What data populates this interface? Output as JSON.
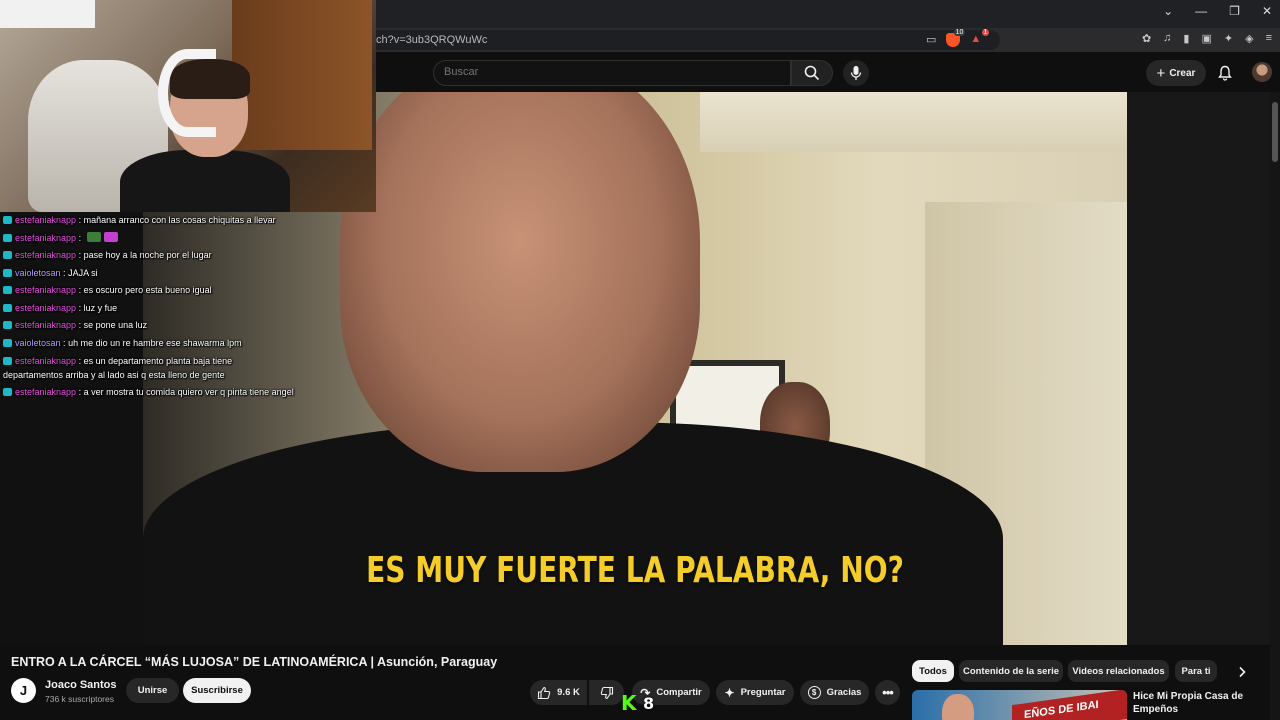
{
  "browser": {
    "url_fragment": "ch?v=3ub3QRQWuWc",
    "shield_count": "10",
    "alert_count": "1",
    "window_controls": {
      "minimize": "⌄",
      "min2": "—",
      "restore": "❐",
      "close": "✕"
    }
  },
  "masthead": {
    "search_placeholder": "Buscar",
    "create_label": "Crear"
  },
  "video": {
    "caption": "ES MUY FUERTE LA PALABRA, NO?",
    "title": "ENTRO A LA CÁRCEL “MÁS LUJOSA” DE LATINOAMÉRICA | Asunción, Paraguay",
    "channel": {
      "avatar_letter": "J",
      "name": "Joaco Santos",
      "subscribers": "736 k suscriptores"
    },
    "join_label": "Unirse",
    "subscribe_label": "Suscribirse",
    "like_count": "9.6 K",
    "share_label": "Compartir",
    "ask_label": "Preguntar",
    "thanks_label": "Gracias"
  },
  "kick_overlay": {
    "logo": "K",
    "count": "8"
  },
  "chat": {
    "messages": [
      {
        "user": "estefaniaknapp",
        "color": "pink",
        "text": "mañana arranco con las cosas chiquitas a llevar"
      },
      {
        "user": "estefaniaknapp",
        "color": "pink",
        "text": ""
      },
      {
        "user": "estefaniaknapp",
        "color": "pink",
        "text": "pase hoy a la noche por el lugar"
      },
      {
        "user": "vaioletosan",
        "color": "purple",
        "text": "JAJA si"
      },
      {
        "user": "estefaniaknapp",
        "color": "pink",
        "text": "es oscuro pero esta bueno igual"
      },
      {
        "user": "estefaniaknapp",
        "color": "pink",
        "text": "luz y fue"
      },
      {
        "user": "estefaniaknapp",
        "color": "pink",
        "text": "se pone una luz"
      },
      {
        "user": "vaioletosan",
        "color": "purple",
        "text": "uh me dio un re hambre ese shawarma lpm"
      },
      {
        "user": "estefaniaknapp",
        "color": "pink",
        "text": "es un departamento planta baja tiene departamentos arriba y al lado asi q esta lleno de gente"
      },
      {
        "user": "estefaniaknapp",
        "color": "pink",
        "text": "a ver mostra tu comida quiero ver q pinta tiene angel"
      }
    ]
  },
  "chips": [
    "Todos",
    "Contenido de la serie",
    "Videos relacionados",
    "Para ti"
  ],
  "recommendation": {
    "thumb_text": "EÑOS DE IBAI",
    "title": "Hice Mi Propia Casa de Empeños"
  }
}
